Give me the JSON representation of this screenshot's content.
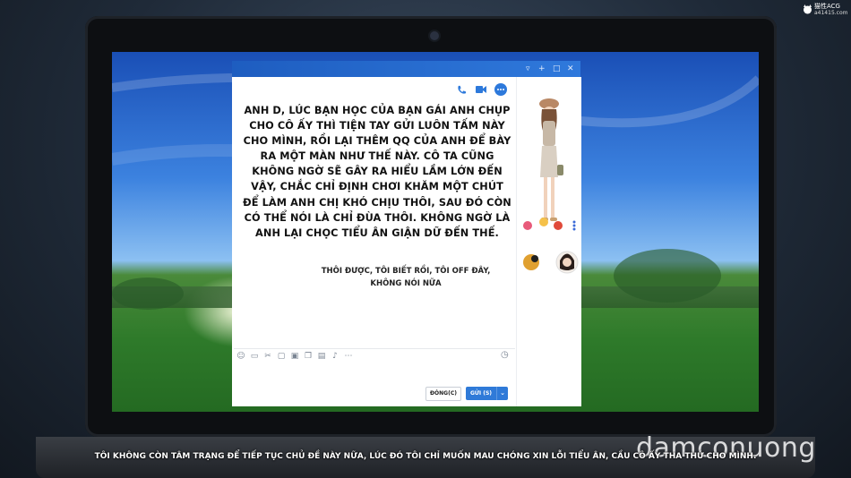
{
  "corner_logo": {
    "brand": "猫性ACG",
    "site": "a41415.com"
  },
  "chat": {
    "message": "ANH D, LÚC BẠN HỌC CỦA BẠN GÁI ANH CHỤP CHO CÔ ẤY THÌ TIỆN TAY GỬI LUÔN TẤM NÀY CHO MÌNH, RỒI LẠI THÊM QQ CỦA ANH ĐỂ BÀY RA MỘT MÀN NHƯ THẾ NÀY. CÔ TA CŨNG KHÔNG NGỜ SẼ GÂY RA HIỂU LẦM LỚN ĐẾN VẬY, CHẮC CHỈ ĐỊNH CHƠI KHĂM MỘT CHÚT ĐỂ LÀM ANH CHỊ KHÓ CHỊU THÔI, SAU ĐÓ CÒN CÓ THỂ NÓI LÀ CHỈ ĐÙA THÔI. KHÔNG NGỜ LÀ ANH LẠI CHỌC TIỂU ÂN GIẬN DỮ ĐẾN THẾ.",
    "reply": "THÔI ĐƯỢC, TÔI BIẾT RỒI, TÔI OFF ĐÂY, KHÔNG NÓI NỮA",
    "close_label": "ĐÓNG(C)",
    "send_label": "GỬI (S)"
  },
  "subtitle": "TÔI KHÔNG CÒN TÂM TRẠNG ĐỂ TIẾP TỤC CHỦ ĐỀ NÀY NỮA, LÚC ĐÓ TÔI CHỈ MUỐN MAU CHÓNG XIN LỖI TIỂU ÂN, CẦU CÔ ẤY THA THỨ CHO MÌNH.",
  "watermark": "damconuong",
  "icons": {
    "window": [
      "minimize-icon",
      "pin-icon",
      "maximize-icon",
      "close-icon"
    ],
    "header": [
      "phone-icon",
      "video-icon",
      "more-icon"
    ],
    "toolbar": [
      "emoji-icon",
      "gif-icon",
      "scissors-icon",
      "folder-icon",
      "image-icon",
      "copy-icon",
      "calendar-icon",
      "music-icon",
      "more-icon"
    ],
    "history": "clock-icon"
  },
  "colors": {
    "titlebar": "#2f79dc",
    "send_button": "#2f7ad8",
    "accent_icon": "#2d79db"
  }
}
